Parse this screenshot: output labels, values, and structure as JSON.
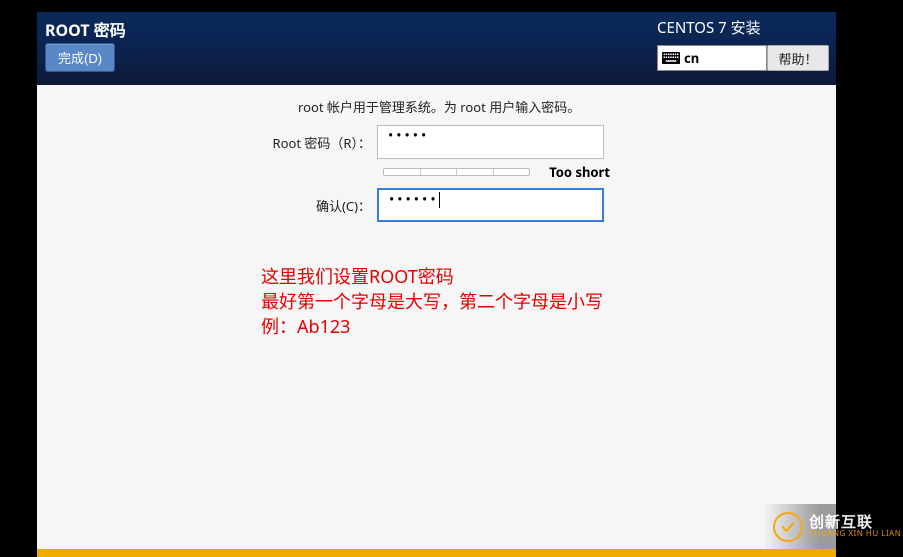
{
  "header": {
    "title_left": "ROOT 密码",
    "title_right": "CENTOS 7 安装",
    "done_label": "完成(D)",
    "help_label": "帮助！",
    "lang_code": "cn"
  },
  "body": {
    "description": "root 帐户用于管理系统。为 root 用户输入密码。",
    "password_label": "Root 密码（R）：",
    "password_value": "•••••",
    "confirm_label": "确认(C)：",
    "confirm_value": "••••••",
    "strength_text": "Too short"
  },
  "annotation": {
    "line1": "这里我们设置ROOT密码",
    "line2": "最好第一个字母是大写，第二个字母是小写",
    "line3": "例：Ab123"
  },
  "watermark": {
    "cn": "创新互联",
    "en": "CHUANG XIN HU LIAN"
  }
}
